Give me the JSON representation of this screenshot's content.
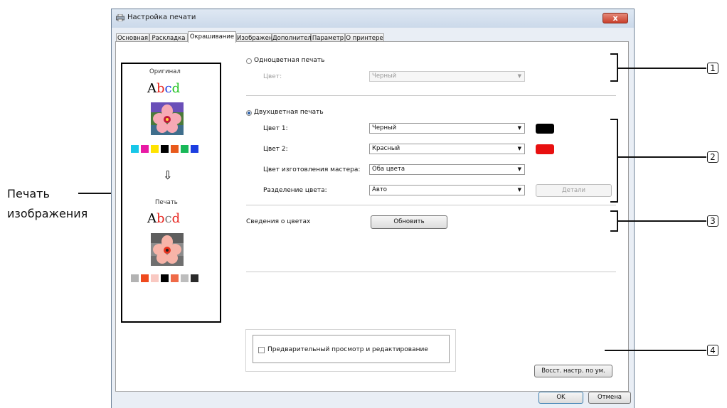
{
  "window": {
    "title": "Настройка печати",
    "close_label": "x"
  },
  "tabs": [
    {
      "label": "Основная"
    },
    {
      "label": "Раскладка"
    },
    {
      "label": "Окрашивание"
    },
    {
      "label": "Изображен."
    },
    {
      "label": "Дополнител"
    },
    {
      "label": "Параметр"
    },
    {
      "label": "О принтере"
    }
  ],
  "preview": {
    "original_label": "Оригинал",
    "print_label": "Печать",
    "abcd_text": "Abcd",
    "letters": [
      "A",
      "b",
      "c",
      "d"
    ],
    "arrow": "⇩",
    "original_letter_colors": [
      "#000000",
      "#e8231d",
      "#1f3ee0",
      "#22c322"
    ],
    "print_letter_colors": [
      "#000000",
      "#e8231d",
      "#7a7a7a",
      "#e8231d"
    ],
    "original_swatches": [
      "#18c7e8",
      "#e81aa4",
      "#ffe300",
      "#000000",
      "#e85a1c",
      "#19b858",
      "#1c3ee0"
    ],
    "print_swatches": [
      "#b3b3b3",
      "#ef4a1e",
      "#f9c9c2",
      "#000000",
      "#ef6a48",
      "#bdbdbd",
      "#2a2a2a"
    ]
  },
  "mono": {
    "radio_label": "Одноцветная печать",
    "color_label": "Цвет:",
    "color_value": "Черный"
  },
  "duo": {
    "radio_label": "Двухцветная печать",
    "color1_label": "Цвет 1:",
    "color1_value": "Черный",
    "color1_swatch": "#000000",
    "color2_label": "Цвет 2:",
    "color2_value": "Красный",
    "color2_swatch": "#e81010",
    "master_label": "Цвет изготовления мастера:",
    "master_value": "Оба цвета",
    "separation_label": "Разделение цвета:",
    "separation_value": "Авто",
    "details_button": "Детали"
  },
  "color_info": {
    "label": "Сведения о цветах",
    "refresh_button": "Обновить"
  },
  "preview_edit": {
    "checkbox_label": "Предварительный просмотр и редактирование",
    "checked": false
  },
  "restore_button": "Восст. настр. по ум.",
  "ok_button": "OK",
  "cancel_button": "Отмена",
  "annotation": {
    "left_label_line1": "Печать",
    "left_label_line2": "изображения",
    "callouts": [
      "1",
      "2",
      "3",
      "4"
    ]
  },
  "colors": {
    "title_bar": "#cbd9ea",
    "close": "#c9402c",
    "radio_selected": "#2b5fa8"
  }
}
